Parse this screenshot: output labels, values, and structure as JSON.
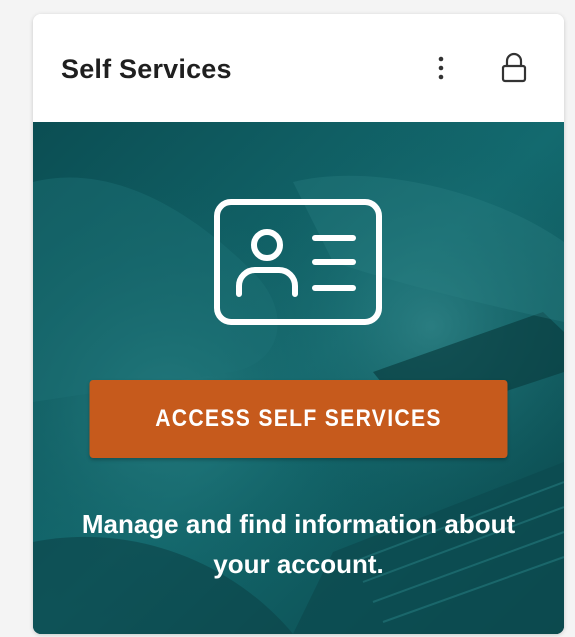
{
  "card": {
    "title": "Self Services",
    "menu_icon": "kebab-vertical-icon",
    "lock_icon": "lock-icon"
  },
  "hero": {
    "icon": "id-card-icon",
    "button_label": "ACCESS SELF SERVICES",
    "description": "Manage and find information about your account."
  },
  "colors": {
    "hero_teal": "#0f5a5f",
    "button_orange": "#c65a1c",
    "title_text": "#1f1f1f"
  }
}
